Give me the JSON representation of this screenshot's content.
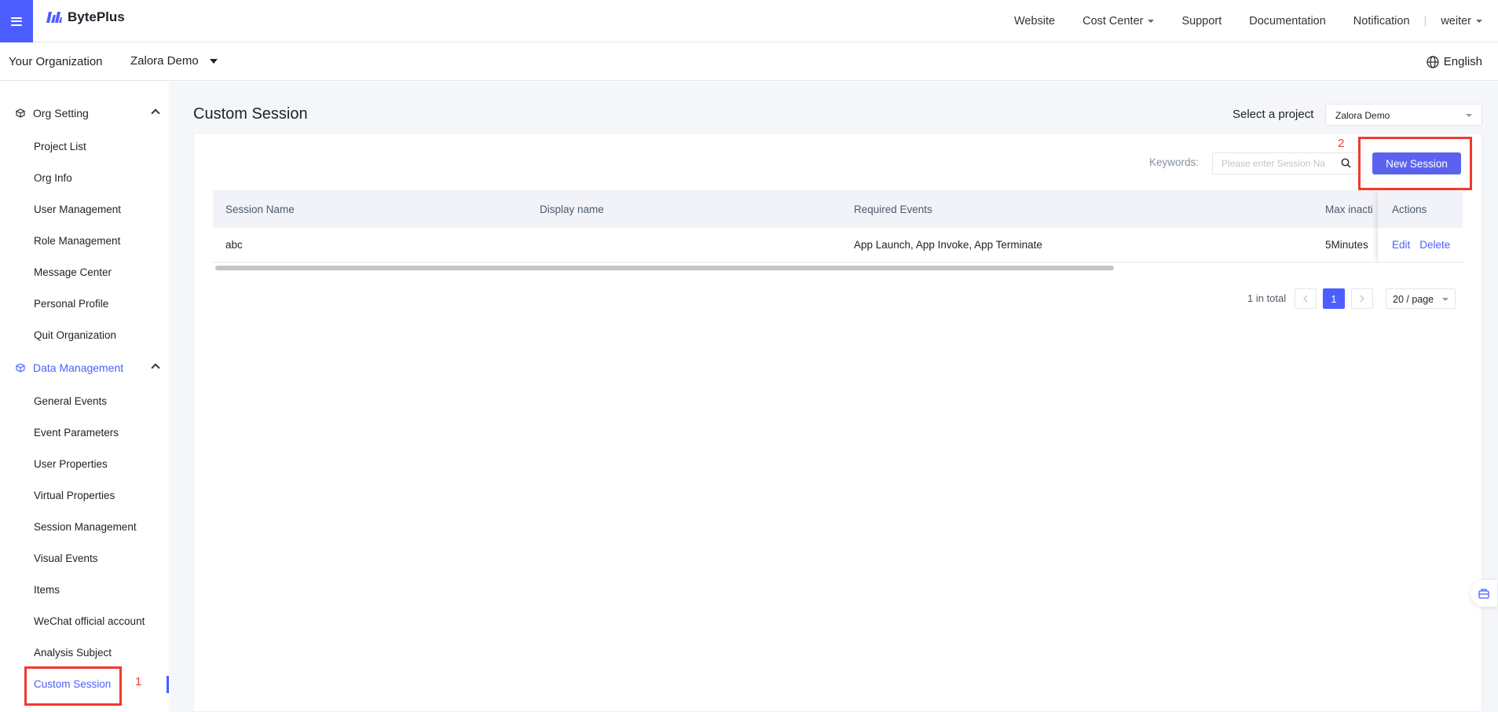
{
  "brand": {
    "name": "BytePlus",
    "accent": "#4c5eff"
  },
  "topnav": {
    "items": [
      "Website",
      "Cost Center",
      "Support",
      "Documentation",
      "Notification"
    ],
    "user": "weiter"
  },
  "org": {
    "label": "Your Organization",
    "selected": "Zalora Demo",
    "language": "English"
  },
  "sidebar": {
    "org_setting": {
      "title": "Org Setting",
      "items": [
        "Project List",
        "Org Info",
        "User Management",
        "Role Management",
        "Message Center",
        "Personal Profile",
        "Quit Organization"
      ]
    },
    "data_management": {
      "title": "Data Management",
      "items": [
        "General Events",
        "Event Parameters",
        "User Properties",
        "Virtual Properties",
        "Session Management",
        "Visual Events",
        "Items",
        "WeChat official account",
        "Analysis Subject",
        "Custom Session"
      ]
    },
    "active_item": "Custom Session"
  },
  "page": {
    "title": "Custom Session",
    "project_label": "Select a project",
    "project_value": "Zalora Demo"
  },
  "toolbar": {
    "keywords_label": "Keywords:",
    "search_placeholder": "Please enter Session Na",
    "new_button": "New Session"
  },
  "table": {
    "columns": [
      "Session Name",
      "Display name",
      "Required Events",
      "Max inacti",
      "Actions"
    ],
    "rows": [
      {
        "session_name": "abc",
        "display_name": "",
        "required_events": "App Launch, App Invoke, App Terminate",
        "max_inactive": "5Minutes",
        "edit": "Edit",
        "delete": "Delete"
      }
    ]
  },
  "pagination": {
    "total": "1 in total",
    "current_page": "1",
    "page_size": "20 / page"
  },
  "annotations": [
    "1",
    "2"
  ]
}
